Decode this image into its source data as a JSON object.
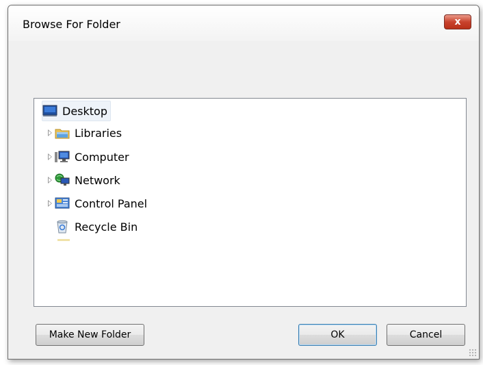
{
  "window": {
    "title": "Browse For Folder",
    "close_label": "x"
  },
  "tree": {
    "items": [
      {
        "label": "Desktop",
        "icon": "desktop-icon",
        "expandable": false,
        "selected": true
      },
      {
        "label": "Libraries",
        "icon": "libraries-icon",
        "expandable": true,
        "selected": false
      },
      {
        "label": "Computer",
        "icon": "computer-icon",
        "expandable": true,
        "selected": false
      },
      {
        "label": "Network",
        "icon": "network-icon",
        "expandable": true,
        "selected": false
      },
      {
        "label": "Control Panel",
        "icon": "control-panel-icon",
        "expandable": true,
        "selected": false
      },
      {
        "label": "Recycle Bin",
        "icon": "recycle-bin-icon",
        "expandable": false,
        "selected": false
      }
    ]
  },
  "buttons": {
    "make_new_folder": "Make New Folder",
    "ok": "OK",
    "cancel": "Cancel"
  }
}
